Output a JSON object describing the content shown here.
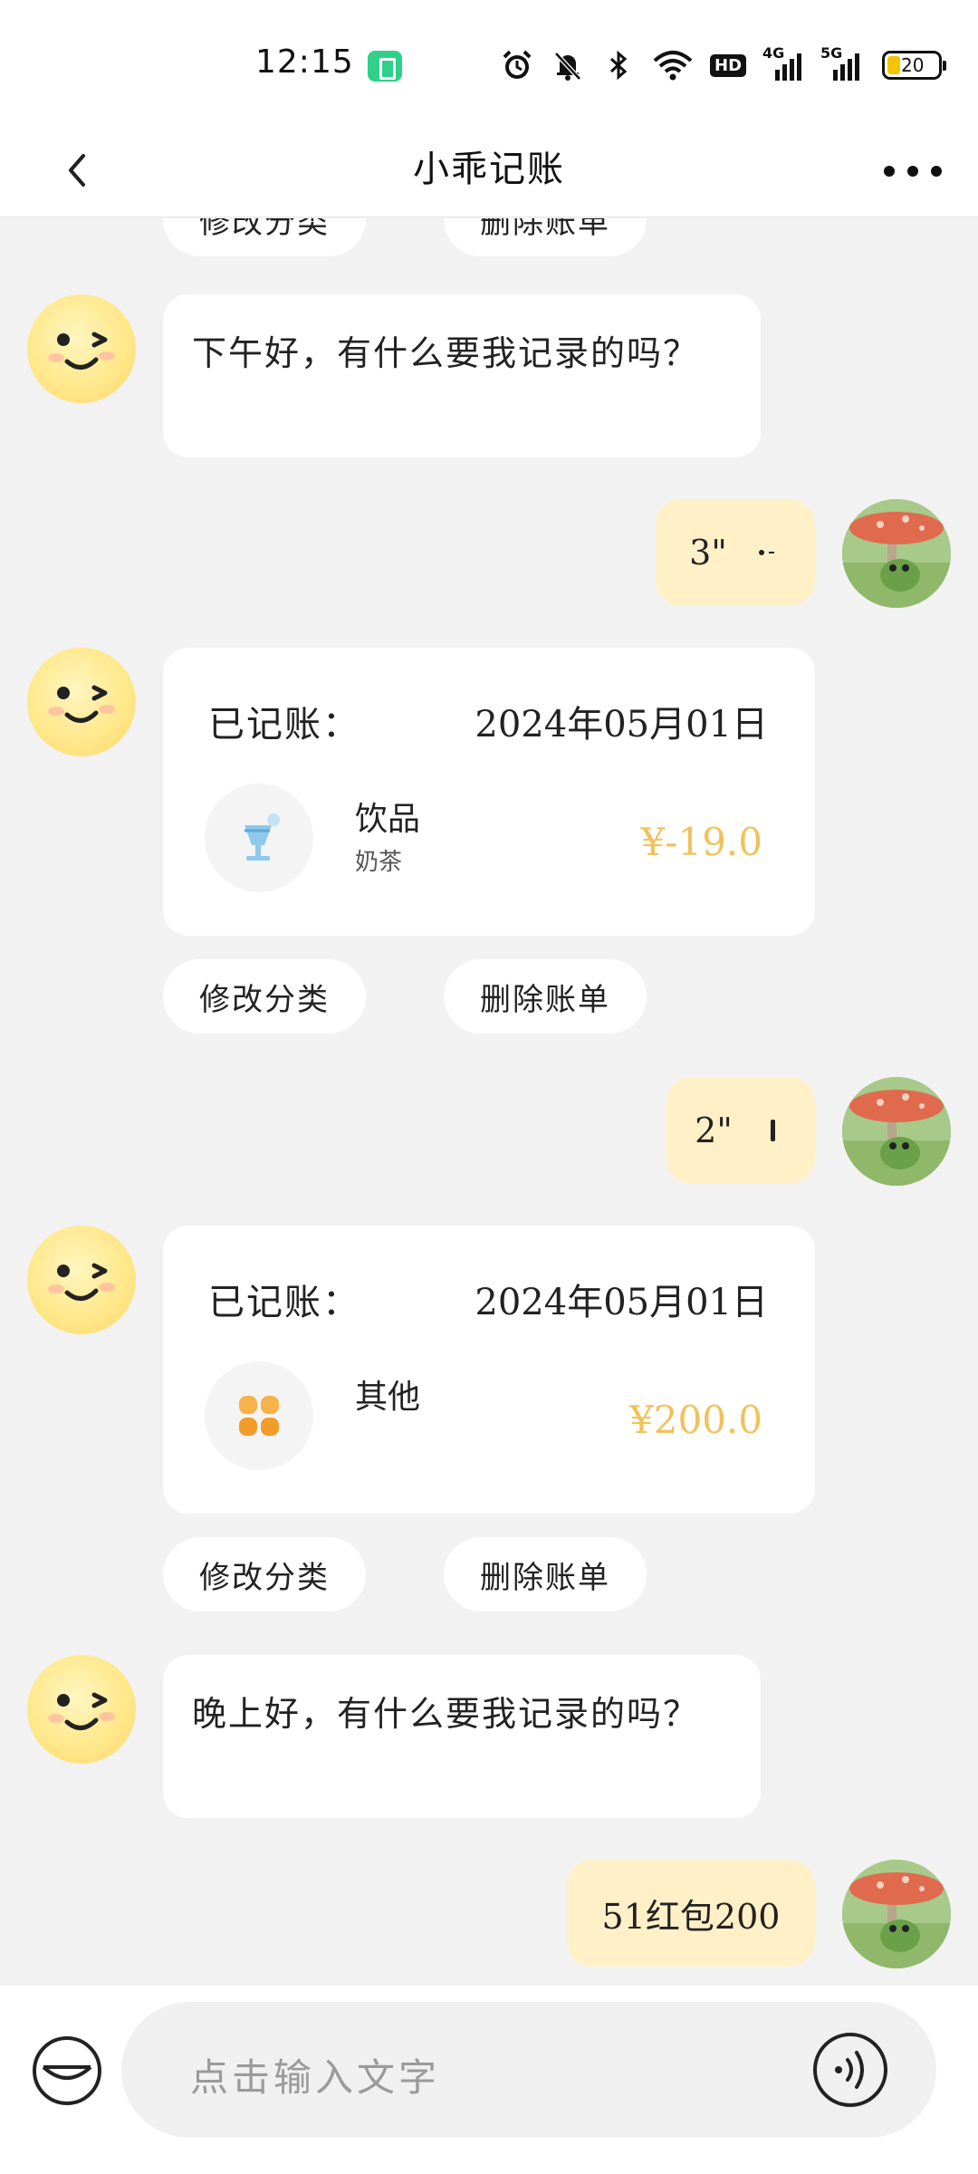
{
  "status_bar": {
    "time": "12:15",
    "hd_label": "HD",
    "net_4g": "4G",
    "net_5g": "5G",
    "battery": "20"
  },
  "header": {
    "title": "小乖记账"
  },
  "chat": {
    "partial_top": {
      "edit": "修改分类",
      "delete": "删除账单"
    },
    "greeting_afternoon": "下午好，有什么要我记录的吗？",
    "voice_msg_1": "3\"",
    "record_1": {
      "label": "已记账：",
      "date": "2024年05月01日",
      "category": "饮品",
      "note": "奶茶",
      "amount": "¥-19.0",
      "edit": "修改分类",
      "delete": "删除账单"
    },
    "voice_msg_2": "2\"",
    "record_2": {
      "label": "已记账：",
      "date": "2024年05月01日",
      "category": "其他",
      "amount": "¥200.0",
      "edit": "修改分类",
      "delete": "删除账单"
    },
    "greeting_evening": "晚上好，有什么要我记录的吗？",
    "text_msg": "51红包200"
  },
  "input": {
    "placeholder": "点击输入文字"
  },
  "colors": {
    "accent_amount": "#f2c15c",
    "user_bubble": "#fff0c8",
    "background": "#f2f2f2"
  }
}
